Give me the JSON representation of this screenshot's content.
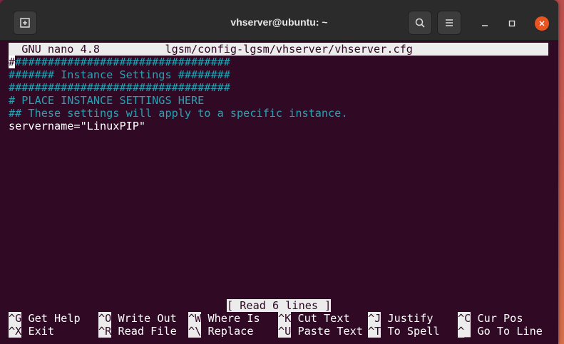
{
  "window": {
    "title": "vhserver@ubuntu: ~"
  },
  "nano": {
    "header_left": "  GNU nano 4.8",
    "header_file": "lgsm/config-lgsm/vhserver/vhserver.cfg",
    "lines": [
      "##################################",
      "####### Instance Settings ########",
      "##################################",
      "# PLACE INSTANCE SETTINGS HERE",
      "## These settings will apply to a specific instance.",
      "servername=\"LinuxPIP\""
    ],
    "status": "[ Read 6 lines ]",
    "shortcuts_row1": [
      {
        "key": "^G",
        "label": "Get Help"
      },
      {
        "key": "^O",
        "label": "Write Out"
      },
      {
        "key": "^W",
        "label": "Where Is"
      },
      {
        "key": "^K",
        "label": "Cut Text"
      },
      {
        "key": "^J",
        "label": "Justify"
      },
      {
        "key": "^C",
        "label": "Cur Pos"
      }
    ],
    "shortcuts_row2": [
      {
        "key": "^X",
        "label": "Exit"
      },
      {
        "key": "^R",
        "label": "Read File"
      },
      {
        "key": "^\\",
        "label": "Replace"
      },
      {
        "key": "^U",
        "label": "Paste Text"
      },
      {
        "key": "^T",
        "label": "To Spell"
      },
      {
        "key": "^_",
        "label": "Go To Line"
      }
    ]
  }
}
